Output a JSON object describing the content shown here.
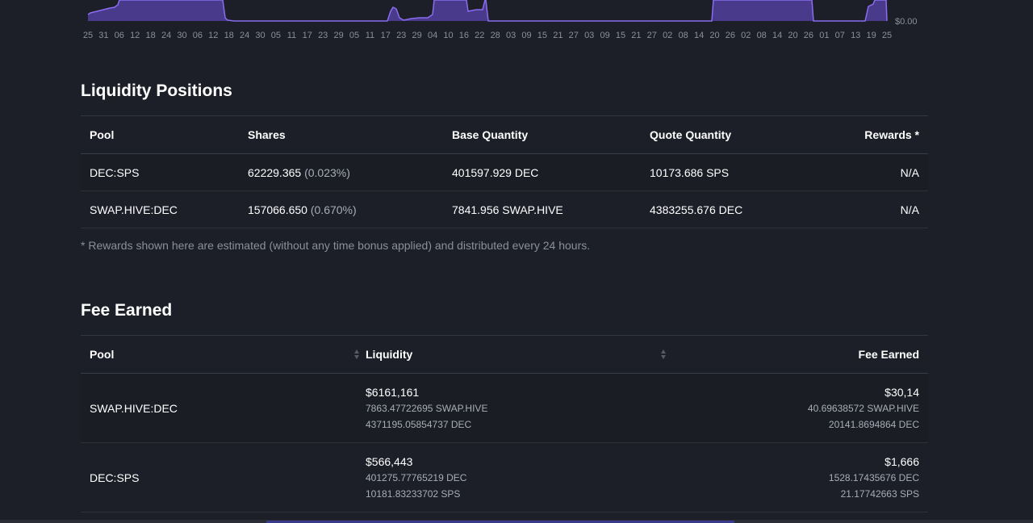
{
  "chart": {
    "y_axis_label": "$0.00",
    "x_tick_labels": [
      "25",
      "31",
      "06",
      "12",
      "18",
      "24",
      "30",
      "06",
      "12",
      "18",
      "24",
      "30",
      "05",
      "11",
      "17",
      "23",
      "29",
      "05",
      "11",
      "17",
      "23",
      "29",
      "04",
      "10",
      "16",
      "22",
      "28",
      "03",
      "09",
      "15",
      "21",
      "27",
      "03",
      "09",
      "15",
      "21",
      "27",
      "02",
      "08",
      "14",
      "20",
      "26",
      "02",
      "08",
      "14",
      "20",
      "26",
      "01",
      "07",
      "13",
      "19",
      "25"
    ],
    "line_color": "#8a6cf0",
    "fill_color": "#4a3a8c"
  },
  "liquidity_positions": {
    "title": "Liquidity Positions",
    "columns": {
      "pool": "Pool",
      "shares": "Shares",
      "base": "Base Quantity",
      "quote": "Quote Quantity",
      "rewards": "Rewards *"
    },
    "rows": [
      {
        "pool": "DEC:SPS",
        "shares": "62229.365",
        "shares_pct": "(0.023%)",
        "base": "401597.929 DEC",
        "quote": "10173.686 SPS",
        "rewards": "N/A"
      },
      {
        "pool": "SWAP.HIVE:DEC",
        "shares": "157066.650",
        "shares_pct": "(0.670%)",
        "base": "7841.956 SWAP.HIVE",
        "quote": "4383255.676 DEC",
        "rewards": "N/A"
      }
    ],
    "footnote": "* Rewards shown here are estimated (without any time bonus applied) and distributed every 24 hours."
  },
  "fee_earned": {
    "title": "Fee Earned",
    "columns": {
      "pool": "Pool",
      "liquidity": "Liquidity",
      "fee": "Fee Earned"
    },
    "rows": [
      {
        "pool": "SWAP.HIVE:DEC",
        "liquidity_usd": "$6161,161",
        "liquidity_line1": "7863.47722695 SWAP.HIVE",
        "liquidity_line2": "4371195.05854737 DEC",
        "fee_usd": "$30,14",
        "fee_line1": "40.69638572 SWAP.HIVE",
        "fee_line2": "20141.8694864 DEC"
      },
      {
        "pool": "DEC:SPS",
        "liquidity_usd": "$566,443",
        "liquidity_line1": "401275.77765219 DEC",
        "liquidity_line2": "10181.83233702 SPS",
        "fee_usd": "$1,666",
        "fee_line1": "1528.17435676 DEC",
        "fee_line2": "21.17742663 SPS"
      }
    ]
  }
}
